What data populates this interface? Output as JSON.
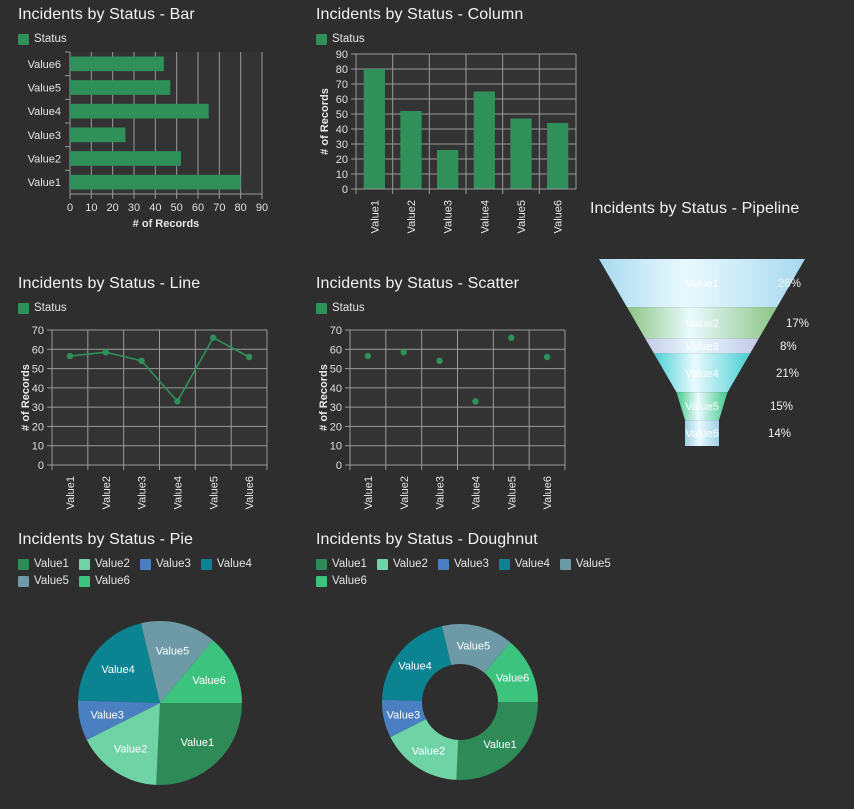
{
  "theme": {
    "background": "#2e2e2e",
    "plot_background": "#333333",
    "grid_color": "#9a9a9a",
    "text_color": "#e8e8e8",
    "series_green": "#2f9159"
  },
  "legend": {
    "single_series_label": "Status",
    "categories": [
      "Value1",
      "Value2",
      "Value3",
      "Value4",
      "Value5",
      "Value6"
    ],
    "category_colors": [
      "#2e8b57",
      "#6fd3a6",
      "#4a7fc1",
      "#0b8391",
      "#6d9aa6",
      "#3cc37e"
    ]
  },
  "panels": {
    "bar": {
      "title": "Incidents by Status - Bar"
    },
    "column": {
      "title": "Incidents by Status - Column"
    },
    "line": {
      "title": "Incidents by Status - Line"
    },
    "scatter": {
      "title": "Incidents by Status - Scatter"
    },
    "pipeline": {
      "title": "Incidents by Status - Pipeline"
    },
    "pie": {
      "title": "Incidents by Status - Pie"
    },
    "doughnut": {
      "title": "Incidents by Status - Doughnut"
    }
  },
  "chart_data": [
    {
      "id": "bar",
      "type": "bar",
      "orientation": "horizontal",
      "title": "Incidents by Status - Bar",
      "xlabel": "# of Records",
      "ylabel": "",
      "legend": [
        "Status"
      ],
      "legend_position": "top-left",
      "grid": true,
      "categories": [
        "Value6",
        "Value5",
        "Value4",
        "Value3",
        "Value2",
        "Value1"
      ],
      "values": [
        44,
        47,
        65,
        26,
        52,
        80
      ],
      "xlim": [
        0,
        90
      ],
      "xticks": [
        0,
        10,
        20,
        30,
        40,
        50,
        60,
        70,
        80,
        90
      ],
      "color": "#2f9159"
    },
    {
      "id": "column",
      "type": "bar",
      "orientation": "vertical",
      "title": "Incidents by Status - Column",
      "xlabel": "",
      "ylabel": "# of Records",
      "legend": [
        "Status"
      ],
      "legend_position": "top-left",
      "grid": true,
      "categories": [
        "Value1",
        "Value2",
        "Value3",
        "Value4",
        "Value5",
        "Value6"
      ],
      "values": [
        80,
        52,
        26,
        65,
        47,
        44
      ],
      "ylim": [
        0,
        90
      ],
      "yticks": [
        0,
        10,
        20,
        30,
        40,
        50,
        60,
        70,
        80,
        90
      ],
      "color": "#2f9159"
    },
    {
      "id": "line",
      "type": "line",
      "title": "Incidents by Status - Line",
      "xlabel": "",
      "ylabel": "# of Records",
      "legend": [
        "Status"
      ],
      "legend_position": "top-left",
      "grid": true,
      "categories": [
        "Value1",
        "Value2",
        "Value3",
        "Value4",
        "Value5",
        "Value6"
      ],
      "values": [
        56.5,
        58.5,
        54,
        33,
        66,
        56
      ],
      "ylim": [
        0,
        70
      ],
      "yticks": [
        0,
        10,
        20,
        30,
        40,
        50,
        60,
        70
      ],
      "color": "#2f9159"
    },
    {
      "id": "scatter",
      "type": "scatter",
      "title": "Incidents by Status - Scatter",
      "xlabel": "",
      "ylabel": "# of Records",
      "legend": [
        "Status"
      ],
      "legend_position": "top-left",
      "grid": true,
      "categories": [
        "Value1",
        "Value2",
        "Value3",
        "Value4",
        "Value5",
        "Value6"
      ],
      "values": [
        56.5,
        58.5,
        54,
        33,
        66,
        56
      ],
      "ylim": [
        0,
        70
      ],
      "yticks": [
        0,
        10,
        20,
        30,
        40,
        50,
        60,
        70
      ],
      "color": "#2f9159"
    },
    {
      "id": "pipeline",
      "type": "funnel",
      "title": "Incidents by Status - Pipeline",
      "labels": [
        "Value1",
        "Value2",
        "Value3",
        "Value4",
        "Value5",
        "Value6"
      ],
      "percent_labels": [
        "26%",
        "17%",
        "8%",
        "21%",
        "15%",
        "14%"
      ],
      "values": [
        26,
        17,
        8,
        21,
        15,
        14
      ],
      "colors": [
        "#a8d9f0",
        "#8cc584",
        "#c3c8e8",
        "#49cfd2",
        "#44c98a",
        "#9fd0e4"
      ]
    },
    {
      "id": "pie",
      "type": "pie",
      "title": "Incidents by Status - Pie",
      "labels": [
        "Value1",
        "Value2",
        "Value3",
        "Value4",
        "Value5",
        "Value6"
      ],
      "values": [
        26,
        17,
        8,
        21,
        15,
        14
      ],
      "percents": [
        26,
        17,
        8,
        21,
        15,
        14
      ],
      "colors": [
        "#2e8b57",
        "#6fd3a6",
        "#4a7fc1",
        "#0b8391",
        "#6d9aa6",
        "#3cc37e"
      ],
      "legend_position": "top-left",
      "start_angle_deg": 0
    },
    {
      "id": "doughnut",
      "type": "pie",
      "variant": "doughnut",
      "title": "Incidents by Status - Doughnut",
      "labels": [
        "Value1",
        "Value2",
        "Value3",
        "Value4",
        "Value5",
        "Value6"
      ],
      "values": [
        26,
        17,
        8,
        21,
        15,
        14
      ],
      "percents": [
        26,
        17,
        8,
        21,
        15,
        14
      ],
      "colors": [
        "#2e8b57",
        "#6fd3a6",
        "#4a7fc1",
        "#0b8391",
        "#6d9aa6",
        "#3cc37e"
      ],
      "legend_position": "top-left",
      "start_angle_deg": 0,
      "inner_radius_ratio": 0.49
    }
  ]
}
